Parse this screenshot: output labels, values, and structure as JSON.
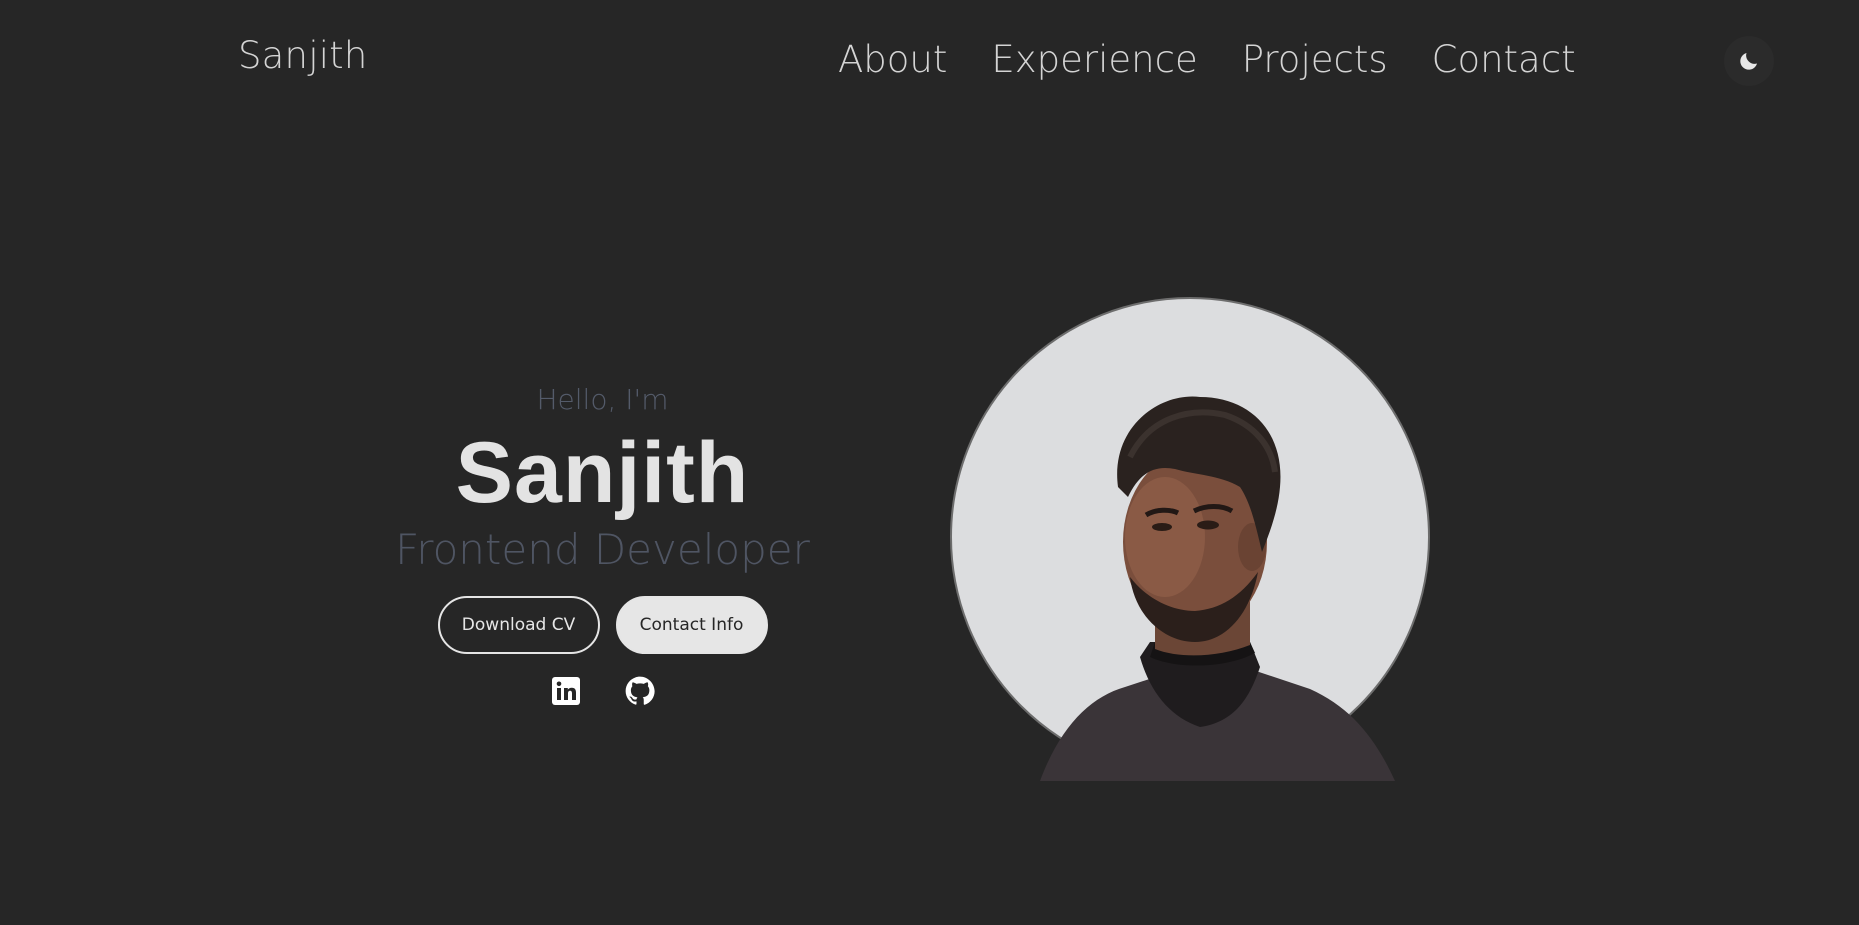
{
  "header": {
    "logo": "Sanjith",
    "nav": [
      "About",
      "Experience",
      "Projects",
      "Contact"
    ],
    "theme_toggle_icon": "moon-icon"
  },
  "hero": {
    "greeting": "Hello, I'm",
    "name": "Sanjith",
    "role": "Frontend Developer",
    "buttons": {
      "download_cv": "Download CV",
      "contact_info": "Contact Info"
    },
    "social_icons": [
      "linkedin-icon",
      "github-icon"
    ],
    "portrait": "profile-photo"
  },
  "colors": {
    "background": "#262626",
    "text_light": "#e3e3e3",
    "text_muted": "#4f5563",
    "portrait_bg": "#dcdddf"
  }
}
